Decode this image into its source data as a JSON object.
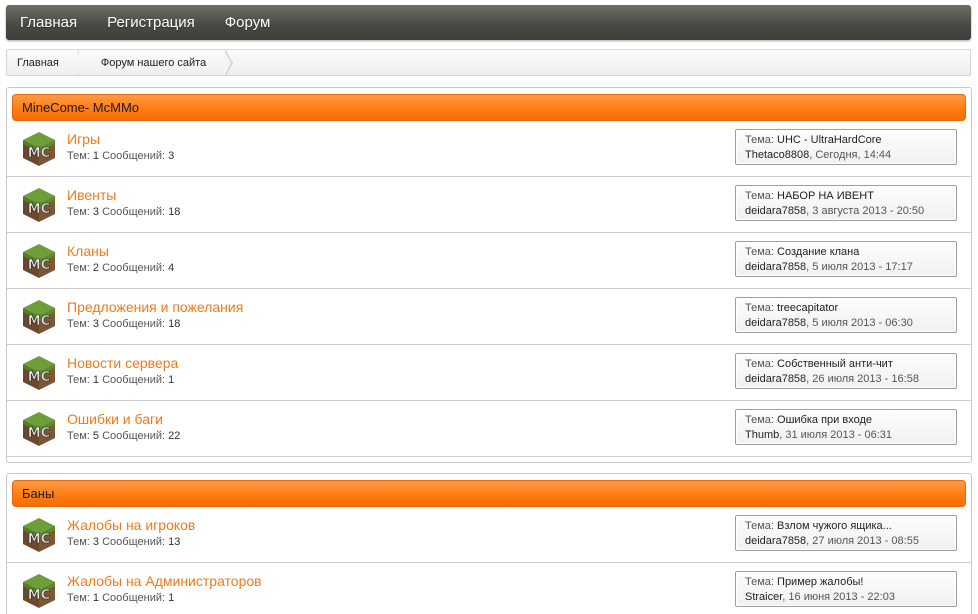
{
  "nav": {
    "items": [
      "Главная",
      "Регистрация",
      "Форум"
    ]
  },
  "breadcrumb": [
    "Главная",
    "Форум нашего сайта"
  ],
  "categories": [
    {
      "title": "MineCome- McMMo",
      "forums": [
        {
          "title": "Игры",
          "topics_label": "Тем:",
          "topics": "1",
          "posts_label": "Сообщений:",
          "posts": "3",
          "last_label": "Тема:",
          "last_topic": "UHC - UltraHardCore",
          "last_author": "Thetaco8808",
          "last_date": ", Сегодня, 14:44"
        },
        {
          "title": "Ивенты",
          "topics_label": "Тем:",
          "topics": "3",
          "posts_label": "Сообщений:",
          "posts": "18",
          "last_label": "Тема:",
          "last_topic": "НАБОР НА ИВЕНТ",
          "last_author": "deidara7858",
          "last_date": ", 3 августа 2013 - 20:50"
        },
        {
          "title": "Кланы",
          "topics_label": "Тем:",
          "topics": "2",
          "posts_label": "Сообщений:",
          "posts": "4",
          "last_label": "Тема:",
          "last_topic": "Создание клана",
          "last_author": "deidara7858",
          "last_date": ", 5 июля 2013 - 17:17"
        },
        {
          "title": "Предложения и пожелания",
          "topics_label": "Тем:",
          "topics": "3",
          "posts_label": "Сообщений:",
          "posts": "18",
          "last_label": "Тема:",
          "last_topic": "treecapitator",
          "last_author": "deidara7858",
          "last_date": ", 5 июля 2013 - 06:30"
        },
        {
          "title": "Новости сервера",
          "topics_label": "Тем:",
          "topics": "1",
          "posts_label": "Сообщений:",
          "posts": "1",
          "last_label": "Тема:",
          "last_topic": "Собственный анти-чит",
          "last_author": "deidara7858",
          "last_date": ", 26 июля 2013 - 16:58"
        },
        {
          "title": "Ошибки и баги",
          "topics_label": "Тем:",
          "topics": "5",
          "posts_label": "Сообщений:",
          "posts": "22",
          "last_label": "Тема:",
          "last_topic": "Ошибка при входе",
          "last_author": "Thumb",
          "last_date": ", 31 июля 2013 - 06:31"
        }
      ]
    },
    {
      "title": "Баны",
      "forums": [
        {
          "title": "Жалобы на игроков",
          "topics_label": "Тем:",
          "topics": "3",
          "posts_label": "Сообщений:",
          "posts": "13",
          "last_label": "Тема:",
          "last_topic": "Взлом чужого ящика...",
          "last_author": "deidara7858",
          "last_date": ", 27 июля 2013 - 08:55"
        },
        {
          "title": "Жалобы на Администраторов",
          "topics_label": "Тем:",
          "topics": "1",
          "posts_label": "Сообщений:",
          "posts": "1",
          "last_label": "Тема:",
          "last_topic": "Пример жалобы!",
          "last_author": "Straicer",
          "last_date": ", 16 июня 2013 - 22:03"
        }
      ]
    }
  ],
  "icon": {
    "name": "minecraft-block-icon",
    "text": "MC",
    "top_color": "#5b8a2e",
    "side_color": "#7a5432"
  },
  "colors": {
    "accent": "#ff7a10",
    "forum_link": "#f07a1a",
    "nav_bg": "#4b4a45"
  }
}
